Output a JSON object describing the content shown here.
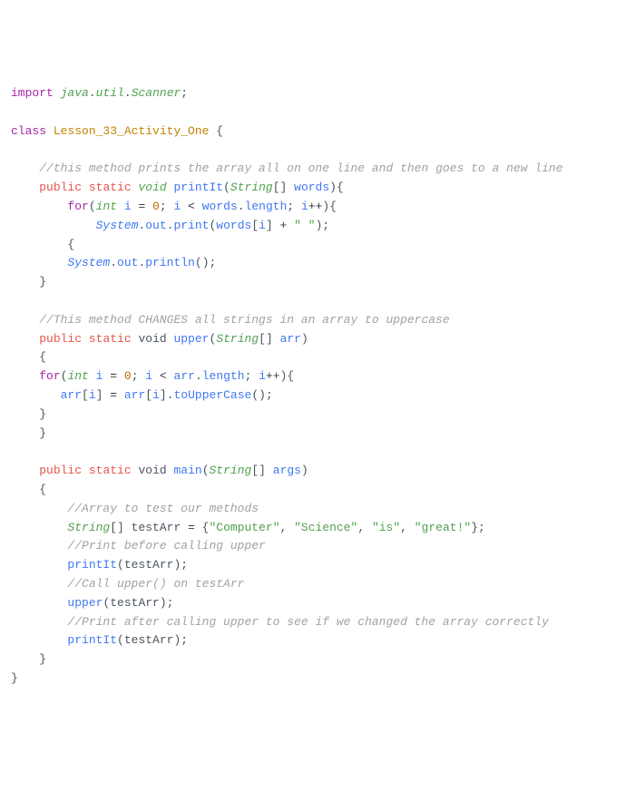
{
  "l1": {
    "import": "import",
    "pkg": "java",
    "d1": ".",
    "util": "util",
    "d2": ".",
    "scanner": "Scanner",
    "semi": ";"
  },
  "l2": {
    "class": "class",
    "name": "Lesson_33_Activity_One",
    "brace": " {"
  },
  "c1": "//this method prints the array all on one line and then goes to a new line",
  "m1": {
    "pub": "public",
    "stat": "static",
    "void": "void",
    "name": "printIt",
    "lp": "(",
    "type": "String",
    "arr": "[]",
    "param": "words",
    "rp": ")",
    "brace": "{"
  },
  "f1": {
    "for": "for",
    "lp": "(",
    "int": "int",
    "i": "i",
    "eq": " = ",
    "zero": "0",
    "semi": ";",
    "i2": "i",
    "lt": " < ",
    "words": "words",
    "dot": ".",
    "len": "length",
    "semi2": ";",
    "i3": "i",
    "inc": "++",
    "rp": ")",
    "brace": "{"
  },
  "p1": {
    "sys": "System",
    "d1": ".",
    "out": "out",
    "d2": ".",
    "print": "print",
    "lp": "(",
    "words": "words",
    "lb": "[",
    "i": "i",
    "rb": "]",
    "plus": " + ",
    "sp": "\" \"",
    "rp": ")",
    "semi": ";"
  },
  "brace_open": "{",
  "p2": {
    "sys": "System",
    "d1": ".",
    "out": "out",
    "d2": ".",
    "println": "println",
    "lp": "(",
    "rp": ")",
    "semi": ";"
  },
  "brace_close": "}",
  "c2": "//This method CHANGES all strings in an array to uppercase",
  "m2": {
    "pub": "public",
    "stat": "static",
    "void": "void",
    "name": "upper",
    "lp": "(",
    "type": "String",
    "arr": "[]",
    "param": "arr",
    "rp": ")"
  },
  "f2": {
    "for": "for",
    "lp": "(",
    "int": "int",
    "i": "i",
    "eq": " = ",
    "zero": "0",
    "semi": ";",
    "i2": "i",
    "lt": " < ",
    "arr": "arr",
    "dot": ".",
    "len": "length",
    "semi2": ";",
    "i3": "i",
    "inc": "++",
    "rp": ")",
    "brace": "{"
  },
  "a1": {
    "arr": "arr",
    "lb": "[",
    "i": "i",
    "rb": "]",
    "eq": " = ",
    "arr2": "arr",
    "lb2": "[",
    "i2": "i",
    "rb2": "]",
    "dot": ".",
    "fn": "toUpperCase",
    "lp": "(",
    "rp": ")",
    "semi": ";"
  },
  "m3": {
    "pub": "public",
    "stat": "static",
    "void": "void",
    "name": "main",
    "lp": "(",
    "type": "String",
    "arr": "[]",
    "param": "args",
    "rp": ")"
  },
  "c3": "//Array to test our methods",
  "d1": {
    "type": "String",
    "arr": "[]",
    "name": "testArr",
    "eq": " = ",
    "lb": "{",
    "s1": "\"Computer\"",
    "c1": ", ",
    "s2": "\"Science\"",
    "c2": ", ",
    "s3": "\"is\"",
    "c3": ", ",
    "s4": "\"great!\"",
    "rb": "}",
    "semi": ";"
  },
  "c4": "//Print before calling upper",
  "call1": {
    "fn": "printIt",
    "lp": "(",
    "arg": "testArr",
    "rp": ")",
    "semi": ";"
  },
  "c5": "//Call upper() on testArr",
  "call2": {
    "fn": "upper",
    "lp": "(",
    "arg": "testArr",
    "rp": ")",
    "semi": ";"
  },
  "c6": "//Print after calling upper to see if we changed the array correctly",
  "call3": {
    "fn": "printIt",
    "lp": "(",
    "arg": "testArr",
    "rp": ")",
    "semi": ";"
  }
}
